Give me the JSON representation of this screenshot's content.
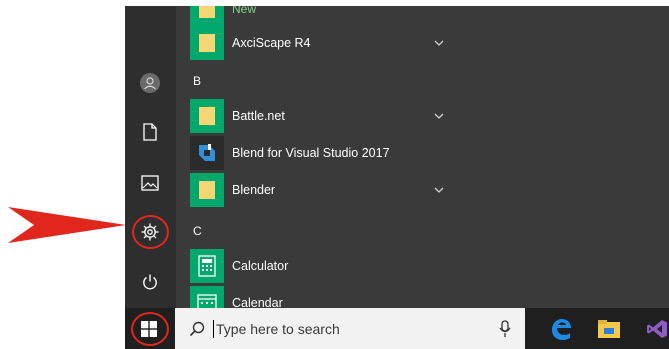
{
  "start_menu": {
    "apps": [
      {
        "label": "New"
      },
      {
        "label": "AxciScape R4",
        "expandable": true
      },
      {
        "label": "Battle.net",
        "expandable": true
      },
      {
        "label": "Blend for Visual Studio 2017",
        "expandable": false
      },
      {
        "label": "Blender",
        "expandable": true
      },
      {
        "label": "Calculator",
        "expandable": false
      },
      {
        "label": "Calendar",
        "expandable": false
      }
    ],
    "letters": [
      "B",
      "C"
    ],
    "rail_icons": [
      "user-avatar-icon",
      "document-icon",
      "pictures-icon",
      "settings-gear-icon",
      "power-icon"
    ]
  },
  "taskbar": {
    "search": {
      "placeholder": "Type here to search"
    },
    "pinned": [
      "edge-icon",
      "file-explorer-icon",
      "visual-studio-icon"
    ]
  },
  "colors": {
    "highlight": "#e0261d",
    "tile": "#00a86b",
    "menu_bg": "#3a3a3a",
    "taskbar_bg": "#1f1f1f"
  }
}
